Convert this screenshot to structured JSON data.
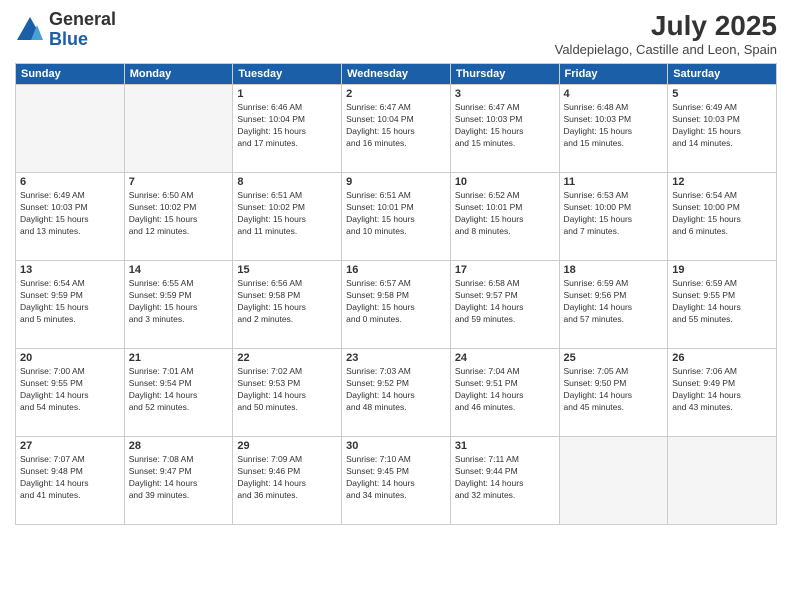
{
  "logo": {
    "general": "General",
    "blue": "Blue"
  },
  "title": {
    "month_year": "July 2025",
    "location": "Valdepielago, Castille and Leon, Spain"
  },
  "days_of_week": [
    "Sunday",
    "Monday",
    "Tuesday",
    "Wednesday",
    "Thursday",
    "Friday",
    "Saturday"
  ],
  "weeks": [
    [
      {
        "day": "",
        "info": ""
      },
      {
        "day": "",
        "info": ""
      },
      {
        "day": "1",
        "info": "Sunrise: 6:46 AM\nSunset: 10:04 PM\nDaylight: 15 hours\nand 17 minutes."
      },
      {
        "day": "2",
        "info": "Sunrise: 6:47 AM\nSunset: 10:04 PM\nDaylight: 15 hours\nand 16 minutes."
      },
      {
        "day": "3",
        "info": "Sunrise: 6:47 AM\nSunset: 10:03 PM\nDaylight: 15 hours\nand 15 minutes."
      },
      {
        "day": "4",
        "info": "Sunrise: 6:48 AM\nSunset: 10:03 PM\nDaylight: 15 hours\nand 15 minutes."
      },
      {
        "day": "5",
        "info": "Sunrise: 6:49 AM\nSunset: 10:03 PM\nDaylight: 15 hours\nand 14 minutes."
      }
    ],
    [
      {
        "day": "6",
        "info": "Sunrise: 6:49 AM\nSunset: 10:03 PM\nDaylight: 15 hours\nand 13 minutes."
      },
      {
        "day": "7",
        "info": "Sunrise: 6:50 AM\nSunset: 10:02 PM\nDaylight: 15 hours\nand 12 minutes."
      },
      {
        "day": "8",
        "info": "Sunrise: 6:51 AM\nSunset: 10:02 PM\nDaylight: 15 hours\nand 11 minutes."
      },
      {
        "day": "9",
        "info": "Sunrise: 6:51 AM\nSunset: 10:01 PM\nDaylight: 15 hours\nand 10 minutes."
      },
      {
        "day": "10",
        "info": "Sunrise: 6:52 AM\nSunset: 10:01 PM\nDaylight: 15 hours\nand 8 minutes."
      },
      {
        "day": "11",
        "info": "Sunrise: 6:53 AM\nSunset: 10:00 PM\nDaylight: 15 hours\nand 7 minutes."
      },
      {
        "day": "12",
        "info": "Sunrise: 6:54 AM\nSunset: 10:00 PM\nDaylight: 15 hours\nand 6 minutes."
      }
    ],
    [
      {
        "day": "13",
        "info": "Sunrise: 6:54 AM\nSunset: 9:59 PM\nDaylight: 15 hours\nand 5 minutes."
      },
      {
        "day": "14",
        "info": "Sunrise: 6:55 AM\nSunset: 9:59 PM\nDaylight: 15 hours\nand 3 minutes."
      },
      {
        "day": "15",
        "info": "Sunrise: 6:56 AM\nSunset: 9:58 PM\nDaylight: 15 hours\nand 2 minutes."
      },
      {
        "day": "16",
        "info": "Sunrise: 6:57 AM\nSunset: 9:58 PM\nDaylight: 15 hours\nand 0 minutes."
      },
      {
        "day": "17",
        "info": "Sunrise: 6:58 AM\nSunset: 9:57 PM\nDaylight: 14 hours\nand 59 minutes."
      },
      {
        "day": "18",
        "info": "Sunrise: 6:59 AM\nSunset: 9:56 PM\nDaylight: 14 hours\nand 57 minutes."
      },
      {
        "day": "19",
        "info": "Sunrise: 6:59 AM\nSunset: 9:55 PM\nDaylight: 14 hours\nand 55 minutes."
      }
    ],
    [
      {
        "day": "20",
        "info": "Sunrise: 7:00 AM\nSunset: 9:55 PM\nDaylight: 14 hours\nand 54 minutes."
      },
      {
        "day": "21",
        "info": "Sunrise: 7:01 AM\nSunset: 9:54 PM\nDaylight: 14 hours\nand 52 minutes."
      },
      {
        "day": "22",
        "info": "Sunrise: 7:02 AM\nSunset: 9:53 PM\nDaylight: 14 hours\nand 50 minutes."
      },
      {
        "day": "23",
        "info": "Sunrise: 7:03 AM\nSunset: 9:52 PM\nDaylight: 14 hours\nand 48 minutes."
      },
      {
        "day": "24",
        "info": "Sunrise: 7:04 AM\nSunset: 9:51 PM\nDaylight: 14 hours\nand 46 minutes."
      },
      {
        "day": "25",
        "info": "Sunrise: 7:05 AM\nSunset: 9:50 PM\nDaylight: 14 hours\nand 45 minutes."
      },
      {
        "day": "26",
        "info": "Sunrise: 7:06 AM\nSunset: 9:49 PM\nDaylight: 14 hours\nand 43 minutes."
      }
    ],
    [
      {
        "day": "27",
        "info": "Sunrise: 7:07 AM\nSunset: 9:48 PM\nDaylight: 14 hours\nand 41 minutes."
      },
      {
        "day": "28",
        "info": "Sunrise: 7:08 AM\nSunset: 9:47 PM\nDaylight: 14 hours\nand 39 minutes."
      },
      {
        "day": "29",
        "info": "Sunrise: 7:09 AM\nSunset: 9:46 PM\nDaylight: 14 hours\nand 36 minutes."
      },
      {
        "day": "30",
        "info": "Sunrise: 7:10 AM\nSunset: 9:45 PM\nDaylight: 14 hours\nand 34 minutes."
      },
      {
        "day": "31",
        "info": "Sunrise: 7:11 AM\nSunset: 9:44 PM\nDaylight: 14 hours\nand 32 minutes."
      },
      {
        "day": "",
        "info": ""
      },
      {
        "day": "",
        "info": ""
      }
    ]
  ]
}
